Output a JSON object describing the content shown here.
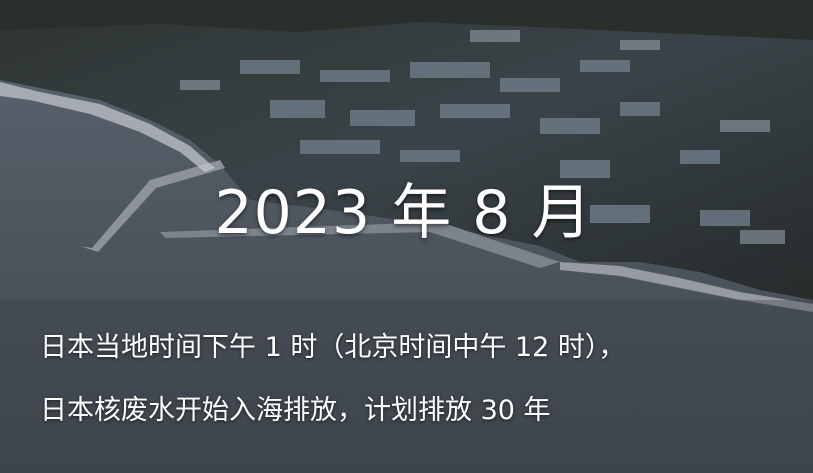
{
  "headline": "2023 年 8 月",
  "caption_lines": [
    "日本当地时间下午 1 时（北京时间中午 12 时），",
    "日本核废水开始入海排放，计划排放 30 年"
  ]
}
